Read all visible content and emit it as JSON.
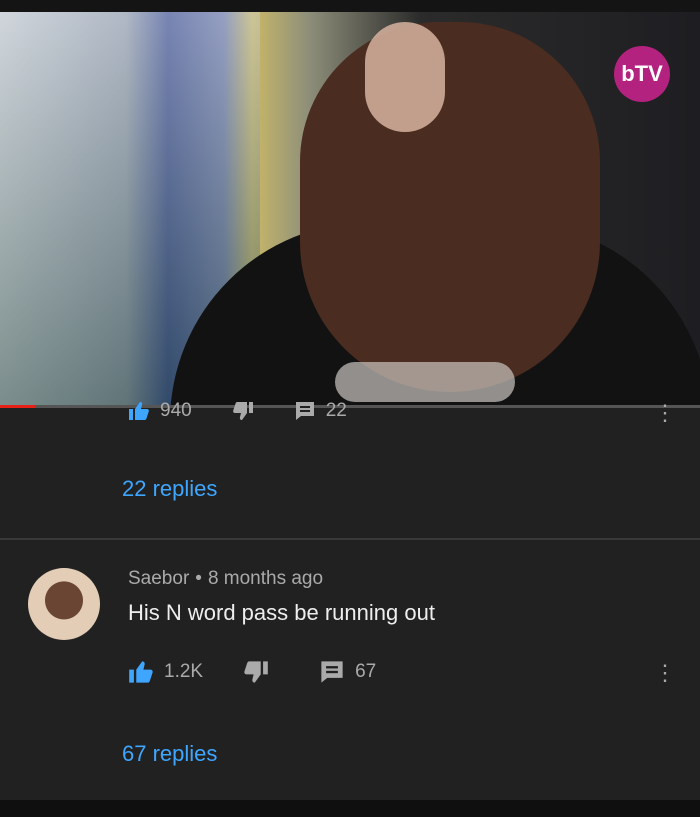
{
  "video": {
    "channel_logo": "bTV",
    "progress": 0.05
  },
  "prev_comment": {
    "likes": "940",
    "reply_count": "22",
    "replies_label": "22 replies"
  },
  "comment": {
    "author": "Saebor",
    "time": "8 months ago",
    "text": "His N word pass be running out",
    "likes": "1.2K",
    "reply_count": "67",
    "replies_label": "67 replies"
  },
  "icons": {
    "like": "thumbs-up-icon",
    "dislike": "thumbs-down-icon",
    "reply": "comment-icon",
    "more": "vertical-dots-icon"
  },
  "colors": {
    "link": "#3ea6ff",
    "background": "#212121",
    "progress": "#e62117"
  }
}
